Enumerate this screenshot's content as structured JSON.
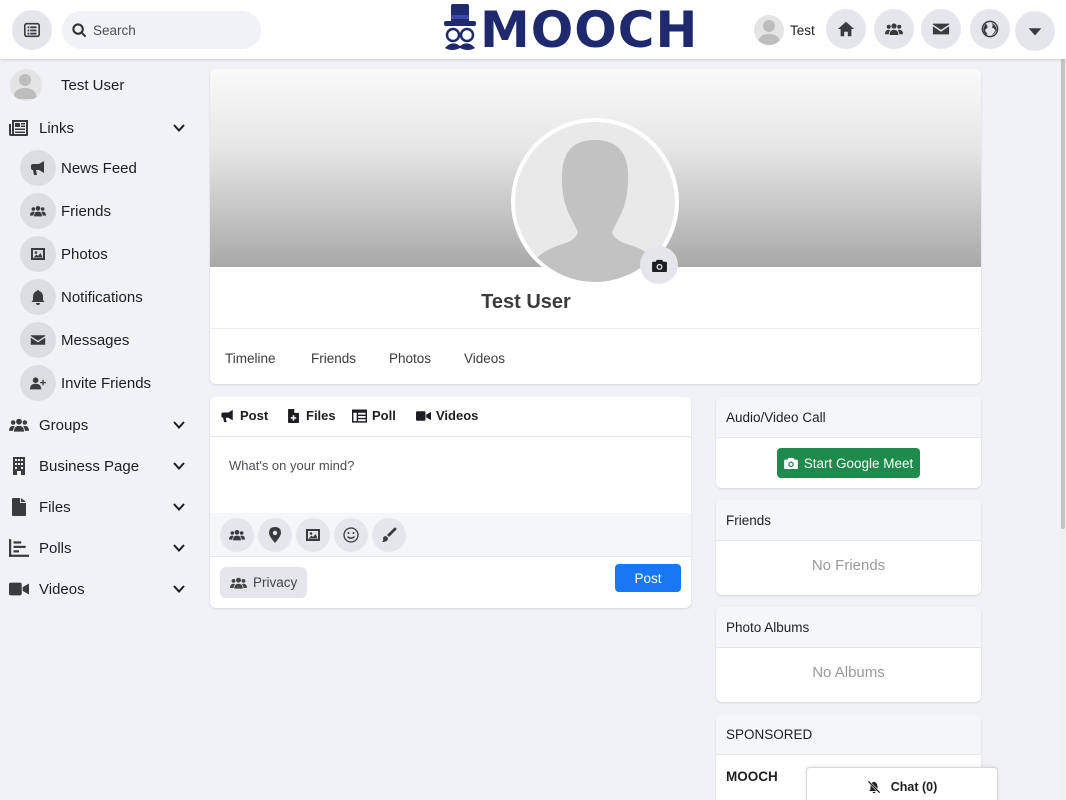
{
  "header": {
    "search_placeholder": "Search",
    "logo_text": "MOOCH",
    "user_name": "Test",
    "icons": [
      "menu-icon",
      "search-icon",
      "home-icon",
      "friends-icon",
      "envelope-icon",
      "globe-icon",
      "caret-down-icon"
    ]
  },
  "sidebar": {
    "user_name": "Test User",
    "links_label": "Links",
    "links": [
      {
        "label": "News Feed",
        "icon": "megaphone-icon"
      },
      {
        "label": "Friends",
        "icon": "friends-icon"
      },
      {
        "label": "Photos",
        "icon": "image-icon"
      },
      {
        "label": "Notifications",
        "icon": "bell-icon"
      },
      {
        "label": "Messages",
        "icon": "envelope-icon"
      },
      {
        "label": "Invite Friends",
        "icon": "user-plus-icon"
      }
    ],
    "sections": [
      {
        "label": "Groups",
        "icon": "users-icon"
      },
      {
        "label": "Business Page",
        "icon": "building-icon"
      },
      {
        "label": "Files",
        "icon": "file-icon"
      },
      {
        "label": "Polls",
        "icon": "poll-icon"
      },
      {
        "label": "Videos",
        "icon": "video-icon"
      }
    ]
  },
  "profile": {
    "name": "Test User",
    "tabs": [
      "Timeline",
      "Friends",
      "Photos",
      "Videos"
    ]
  },
  "composer": {
    "tabs": [
      "Post",
      "Files",
      "Poll",
      "Videos"
    ],
    "placeholder": "What's on your mind?",
    "tools": [
      "tag-friends-icon",
      "location-icon",
      "image-icon",
      "emoji-icon",
      "paintbrush-icon"
    ],
    "privacy_label": "Privacy",
    "post_label": "Post"
  },
  "widgets": {
    "call": {
      "title": "Audio/Video Call",
      "button": "Start Google Meet"
    },
    "friends": {
      "title": "Friends",
      "empty": "No Friends"
    },
    "albums": {
      "title": "Photo Albums",
      "empty": "No Albums"
    },
    "sponsored": {
      "title": "SPONSORED",
      "brand": "MOOCH"
    }
  },
  "chat": {
    "label": "Chat (0)"
  },
  "colors": {
    "brand": "#1f2a6e",
    "post_button": "#1877f2",
    "meet_button": "#1e8a4c"
  }
}
